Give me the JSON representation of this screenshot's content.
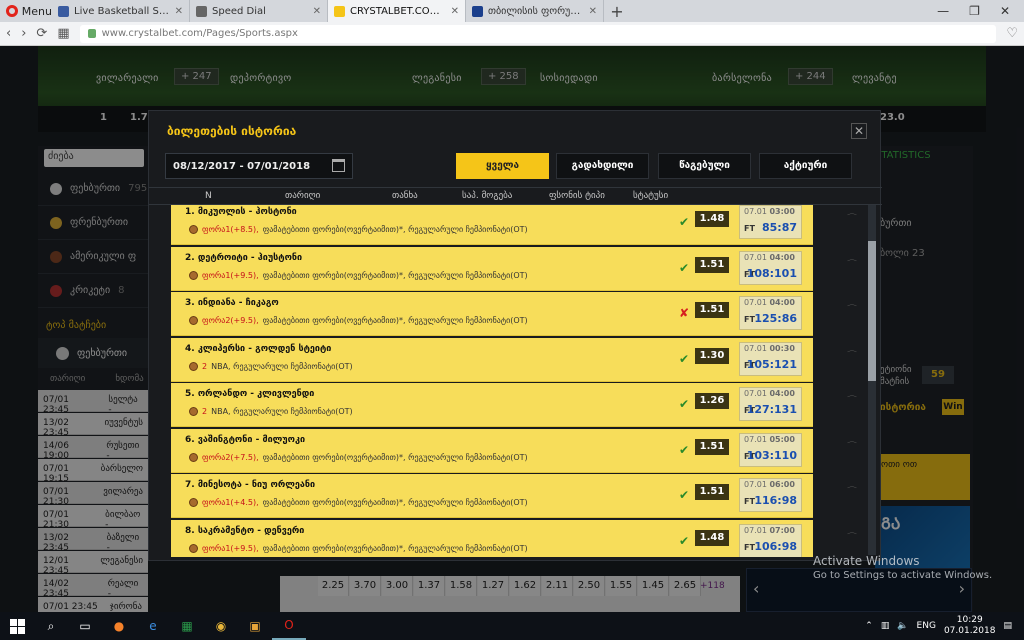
{
  "browser": {
    "menu_label": "Menu",
    "tabs": [
      {
        "label": "Live Basketball Scores - N",
        "active": false,
        "color": "#3a5ba0"
      },
      {
        "label": "Speed Dial",
        "active": false,
        "color": "#666"
      },
      {
        "label": "CRYSTALBET.COM - ონლ",
        "active": true,
        "color": "#f5c518"
      },
      {
        "label": "თბილისის ფორუმი - P",
        "active": false,
        "color": "#1b3f8c"
      }
    ],
    "url": "www.crystalbet.com/Pages/Sports.aspx"
  },
  "banner": {
    "teams": [
      "ვილარეალი",
      "დეპორტივო",
      "ლეგანესი",
      "სოსიედადი",
      "ბარსელონა",
      "ლევანტე"
    ],
    "plus": [
      "+ 247",
      "+ 258",
      "+ 244"
    ],
    "odds_left": [
      "1",
      "1.70"
    ],
    "odds_right": "23.0"
  },
  "left": {
    "search": "ძიება",
    "sports": [
      {
        "label": "ფეხბურთი",
        "count": "795",
        "color": "#e6e6e6"
      },
      {
        "label": "ფრენბურთი",
        "count": "",
        "color": "#e4b43a"
      },
      {
        "label": "ამერიკული ფ",
        "count": "",
        "color": "#8a4a2a"
      },
      {
        "label": "კრიკეტი",
        "count": "8",
        "color": "#b33"
      }
    ],
    "top_header": "ტოპ მატჩები",
    "top_sport": "ფეხბურთი",
    "grid_headers": [
      "თარიღი",
      "ხდომა"
    ],
    "grid_rows": [
      {
        "date": "07/01 23:45",
        "name": "სელტა - "
      },
      {
        "date": "13/02 23:45",
        "name": "იუვენტუს"
      },
      {
        "date": "14/06 19:00",
        "name": "რუსეთი -"
      },
      {
        "date": "07/01 19:15",
        "name": "ბარსელო"
      },
      {
        "date": "07/01 21:30",
        "name": "ვილარეა"
      },
      {
        "date": "07/01 21:30",
        "name": "ბილბაო -"
      },
      {
        "date": "13/02 23:45",
        "name": "ბაზელი -"
      },
      {
        "date": "12/01 23:45",
        "name": "ლეგანესი"
      },
      {
        "date": "14/02 23:45",
        "name": "რეალი -"
      },
      {
        "date": "07/01 23:45",
        "name": "ჯირონა"
      }
    ]
  },
  "bottom_odds": [
    "2.25",
    "3.70",
    "3.00",
    "1.37",
    "1.58",
    "1.27",
    "1.62",
    "2.11",
    "2.50",
    "1.55",
    "1.45",
    "2.65"
  ],
  "bottom_plus": "+118",
  "right": {
    "stats": "STATISTICS",
    "r1": "ბურთი",
    "r2": "ბოლი  23",
    "promo_text": "ეტიონი\nმატჩის",
    "promo_num": "59",
    "history": "ისტორია",
    "win": "Win",
    "yellow_text": "ოთი\nოთ",
    "banner_text": "ᲒᲐ"
  },
  "watermark": {
    "title": "Activate Windows",
    "sub": "Go to Settings to activate Windows."
  },
  "modal": {
    "title": "ბილეთების ისტორია",
    "date_range": "08/12/2017 - 07/01/2018",
    "filters": [
      "ყველა",
      "გადახდილი",
      "წაგებული",
      "აქტიური"
    ],
    "columns": [
      "N",
      "თარიღი",
      "თანხა",
      "საპ. მოგება",
      "ფსონის ტიპი",
      "სტატუსი"
    ],
    "rows": [
      {
        "name": "1. მიკუოლის - ჰოსტონი",
        "event": "ფორა1(+8.5),",
        "detail": "ფამატებითი ფორები(ოვერტაიმით)*, რეგულარული ჩემპიონატი(OT)",
        "status": "win",
        "odd": "1.48",
        "date": "07.01",
        "time": "03:00",
        "score": "85:87"
      },
      {
        "name": "2. დეტროიტი - ჰიუსტონი",
        "event": "ფორა1(+9.5),",
        "detail": "ფამატებითი ფორები(ოვერტაიმით)*, რეგულარული ჩემპიონატი(OT)",
        "status": "win",
        "odd": "1.51",
        "date": "07.01",
        "time": "04:00",
        "score": "108:101"
      },
      {
        "name": "3. ინდიანა - ჩიკაგო",
        "event": "ფორა2(+9.5),",
        "detail": "ფამატებითი ფორები(ოვერტაიმით)*, რეგულარული ჩემპიონატი(OT)",
        "status": "lose",
        "odd": "1.51",
        "date": "07.01",
        "time": "04:00",
        "score": "125:86"
      },
      {
        "name": "4. კლიპერსი - გოლდენ სტეიტი",
        "event": "2",
        "detail": "NBA, რეგულარული ჩემპიონატი(OT)",
        "status": "win",
        "odd": "1.30",
        "date": "07.01",
        "time": "00:30",
        "score": "105:121"
      },
      {
        "name": "5. ორლანდო - კლივლენდი",
        "event": "2",
        "detail": "NBA, რეგულარული ჩემპიონატი(OT)",
        "status": "win",
        "odd": "1.26",
        "date": "07.01",
        "time": "04:00",
        "score": "127:131"
      },
      {
        "name": "6. ვაშინგტონი - მილუოკი",
        "event": "ფორა2(+7.5),",
        "detail": "ფამატებითი ფორები(ოვერტაიმით)*, რეგულარული ჩემპიონატი(OT)",
        "status": "win",
        "odd": "1.51",
        "date": "07.01",
        "time": "05:00",
        "score": "103:110"
      },
      {
        "name": "7. მინესოტა - ნიუ ორლეანი",
        "event": "ფორა1(+4.5),",
        "detail": "ფამატებითი ფორები(ოვერტაიმით)*, რეგულარული ჩემპიონატი(OT)",
        "status": "win",
        "odd": "1.51",
        "date": "07.01",
        "time": "06:00",
        "score": "116:98"
      },
      {
        "name": "8. საკრამენტო - დენვერი",
        "event": "ფორა1(+9.5),",
        "detail": "ფამატებითი ფორები(ოვერტაიმით)*, რეგულარული ჩემპიონატი(OT)",
        "status": "win",
        "odd": "1.48",
        "date": "07.01",
        "time": "07:00",
        "score": "106:98"
      }
    ],
    "ft_label": "FT",
    "win_mark": "✔",
    "lose_mark": "✘",
    "close": "✕"
  },
  "taskbar": {
    "lang": "ENG",
    "time": "10:29",
    "date": "07.01.2018"
  }
}
